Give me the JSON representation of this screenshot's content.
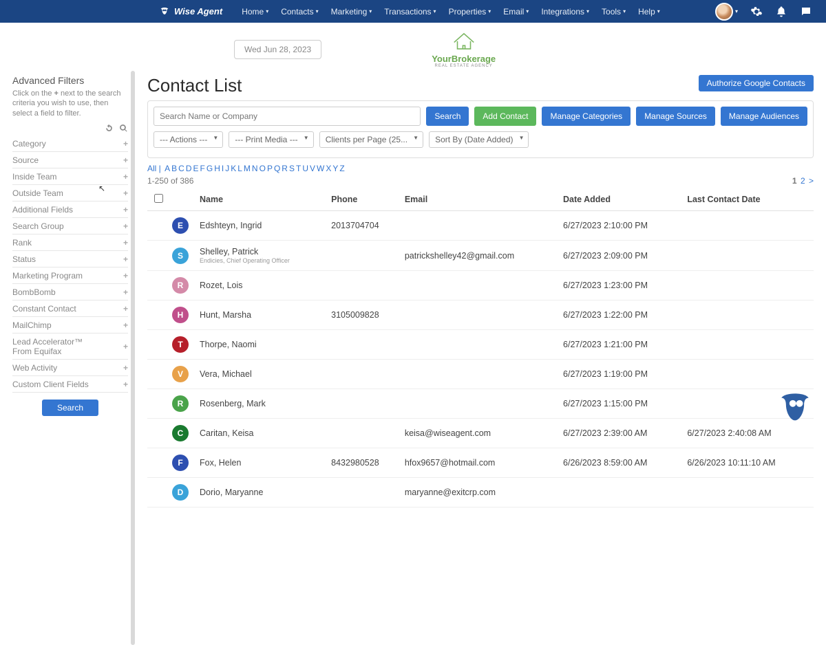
{
  "nav": {
    "brand": "Wise Agent",
    "items": [
      "Home",
      "Contacts",
      "Marketing",
      "Transactions",
      "Properties",
      "Email",
      "Integrations",
      "Tools",
      "Help"
    ]
  },
  "date": "Wed Jun 28, 2023",
  "brokerage": {
    "title": "YourBrokerage",
    "sub": "REAL ESTATE AGENCY"
  },
  "sidebar": {
    "title": "Advanced Filters",
    "help": "Click on the + next to the search criteria you wish to use, then select a field to filter.",
    "rows": [
      "Category",
      "Source",
      "Inside Team",
      "Outside Team",
      "Additional Fields",
      "Search Group",
      "Rank",
      "Status",
      "Marketing Program",
      "BombBomb",
      "Constant Contact",
      "MailChimp",
      "Lead Accelerator™\nFrom Equifax",
      "Web Activity",
      "Custom Client Fields"
    ],
    "search_btn": "Search"
  },
  "page": {
    "title": "Contact List",
    "auth_btn": "Authorize Google Contacts",
    "search_placeholder": "Search Name or Company",
    "search_btn": "Search",
    "add_btn": "Add Contact",
    "manage_cats": "Manage Categories",
    "manage_src": "Manage Sources",
    "manage_aud": "Manage Audiences",
    "sel_actions": "--- Actions ---",
    "sel_print": "--- Print Media ---",
    "sel_clients": "Clients per Page (25...",
    "sel_sort": "Sort By (Date Added)",
    "alpha_all": "All",
    "alpha": [
      "A",
      "B",
      "C",
      "D",
      "E",
      "F",
      "G",
      "H",
      "I",
      "J",
      "K",
      "L",
      "M",
      "N",
      "O",
      "P",
      "Q",
      "R",
      "S",
      "T",
      "U",
      "V",
      "W",
      "X",
      "Y",
      "Z"
    ],
    "range": "1-250 of 386",
    "pager_current": "1",
    "pager_next": "2",
    "pager_arrow": ">"
  },
  "table": {
    "headers": [
      "Name",
      "Phone",
      "Email",
      "Date Added",
      "Last Contact Date"
    ],
    "rows": [
      {
        "initial": "E",
        "color": "#2d4fb0",
        "name": "Edshteyn, Ingrid",
        "role": "",
        "phone": "2013704704",
        "email": "",
        "date": "6/27/2023 2:10:00 PM",
        "last": ""
      },
      {
        "initial": "S",
        "color": "#3aa3d9",
        "name": "Shelley, Patrick",
        "role": "Endicies, Chief Operating Officer",
        "phone": "",
        "email": "patrickshelley42@gmail.com",
        "date": "6/27/2023 2:09:00 PM",
        "last": ""
      },
      {
        "initial": "R",
        "color": "#d48aa8",
        "name": "Rozet, Lois",
        "role": "",
        "phone": "",
        "email": "",
        "date": "6/27/2023 1:23:00 PM",
        "last": ""
      },
      {
        "initial": "H",
        "color": "#c04f8b",
        "name": "Hunt, Marsha",
        "role": "",
        "phone": "3105009828",
        "email": "",
        "date": "6/27/2023 1:22:00 PM",
        "last": ""
      },
      {
        "initial": "T",
        "color": "#b61f2a",
        "name": "Thorpe, Naomi",
        "role": "",
        "phone": "",
        "email": "",
        "date": "6/27/2023 1:21:00 PM",
        "last": ""
      },
      {
        "initial": "V",
        "color": "#e8a14a",
        "name": "Vera, Michael",
        "role": "",
        "phone": "",
        "email": "",
        "date": "6/27/2023 1:19:00 PM",
        "last": ""
      },
      {
        "initial": "R",
        "color": "#4aa34a",
        "name": "Rosenberg, Mark",
        "role": "",
        "phone": "",
        "email": "",
        "date": "6/27/2023 1:15:00 PM",
        "last": ""
      },
      {
        "initial": "C",
        "color": "#1a7a2f",
        "name": "Caritan, Keisa",
        "role": "",
        "phone": "",
        "email": "keisa@wiseagent.com",
        "date": "6/27/2023 2:39:00 AM",
        "last": "6/27/2023 2:40:08 AM"
      },
      {
        "initial": "F",
        "color": "#2d4fb0",
        "name": "Fox, Helen",
        "role": "",
        "phone": "8432980528",
        "email": "hfox9657@hotmail.com",
        "date": "6/26/2023 8:59:00 AM",
        "last": "6/26/2023 10:11:10 AM"
      },
      {
        "initial": "D",
        "color": "#3aa3d9",
        "name": "Dorio, Maryanne",
        "role": "",
        "phone": "",
        "email": "maryanne@exitcrp.com",
        "date": "",
        "last": ""
      }
    ]
  }
}
